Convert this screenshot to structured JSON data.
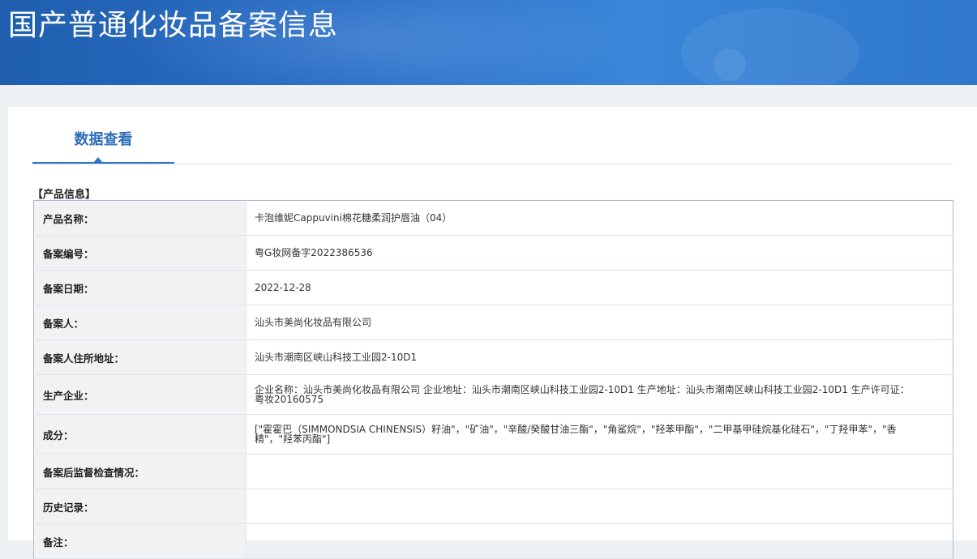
{
  "banner": {
    "title": "国产普通化妆品备案信息"
  },
  "tabs": [
    {
      "label": "数据查看"
    }
  ],
  "section": {
    "title": "【产品信息】"
  },
  "rows": [
    {
      "label": "产品名称：",
      "value": "卡泡维妮Cappuvini棉花糖柔润护唇油（04）"
    },
    {
      "label": "备案编号：",
      "value": "粤G妆网备字2022386536"
    },
    {
      "label": "备案日期：",
      "value": "2022-12-28"
    },
    {
      "label": "备案人：",
      "value": "汕头市美尚化妆品有限公司"
    },
    {
      "label": "备案人住所地址：",
      "value": "汕头市潮南区峡山科技工业园2-10D1"
    },
    {
      "label": "生产企业：",
      "value": "企业名称：汕头市美尚化妆品有限公司 企业地址：汕头市潮南区峡山科技工业园2-10D1 生产地址：汕头市潮南区峡山科技工业园2-10D1 生产许可证：粤妆20160575"
    },
    {
      "label": "成分：",
      "value": "[\"霍霍巴（SIMMONDSIA CHINENSIS）籽油\"，\"矿油\"，\"辛酸/癸酸甘油三酯\"，\"角鲨烷\"，\"羟苯甲酯\"，\"二甲基甲硅烷基化硅石\"，\"丁羟甲苯\"，\"香精\"，\"羟苯丙酯\"]"
    },
    {
      "label": "备案后监督检查情况：",
      "value": ""
    },
    {
      "label": "历史记录：",
      "value": ""
    },
    {
      "label": "备注：",
      "value": ""
    }
  ]
}
